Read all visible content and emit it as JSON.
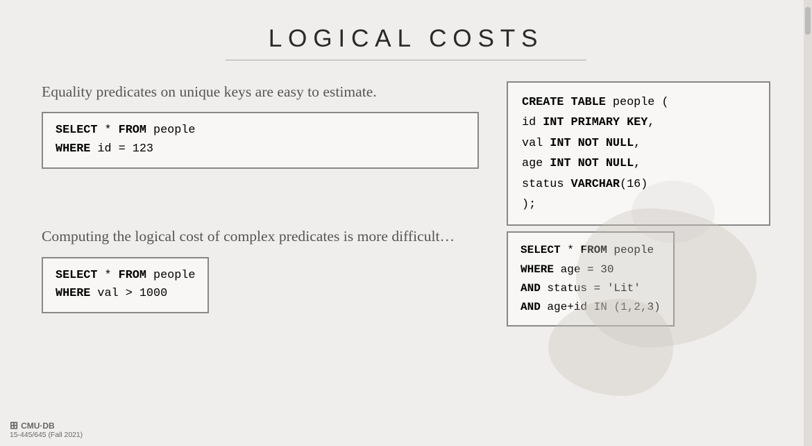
{
  "page": {
    "title": "LOGICAL COSTS",
    "title_divider": true
  },
  "left_top": {
    "text": "Equality predicates on unique keys are easy to estimate.",
    "code": {
      "line1_kw": "SELECT",
      "line1_rest": " * ",
      "line1_kw2": "FROM",
      "line1_rest2": " people",
      "line2_kw": "WHERE",
      "line2_rest": " id = 123"
    }
  },
  "right_top": {
    "code": {
      "line1_kw": "CREATE TABLE",
      "line1_rest": " people (",
      "line2_indent": "  id ",
      "line2_kw": "INT PRIMARY KEY",
      "line2_comma": ",",
      "line3_indent": "  val ",
      "line3_kw": "INT NOT NULL",
      "line3_comma": ",",
      "line4_indent": "  age ",
      "line4_kw": "INT NOT NULL",
      "line4_comma": ",",
      "line5_indent": "  status ",
      "line5_kw": "VARCHAR",
      "line5_rest": "(16)",
      "line6": ");"
    }
  },
  "left_bottom": {
    "text": "Computing the logical cost of complex predicates is more difficult…",
    "code": {
      "line1_kw": "SELECT",
      "line1_rest": " * ",
      "line1_kw2": "FROM",
      "line1_rest2": " people",
      "line2_kw": "WHERE",
      "line2_rest": " val > 1000"
    }
  },
  "right_bottom": {
    "code": {
      "line1_kw": "SELECT",
      "line1_rest": " * ",
      "line1_kw2": "FROM",
      "line1_rest2": " people",
      "line2_kw": "WHERE",
      "line2_rest": " age = 30",
      "line3_kw": "  AND",
      "line3_rest": " status = 'Lit'",
      "line4_kw": "  AND",
      "line4_rest": " age+id IN (1,2,3)"
    }
  },
  "footer": {
    "logo": "CMU·DB",
    "course": "15-445/645 (Fall 2021)"
  }
}
